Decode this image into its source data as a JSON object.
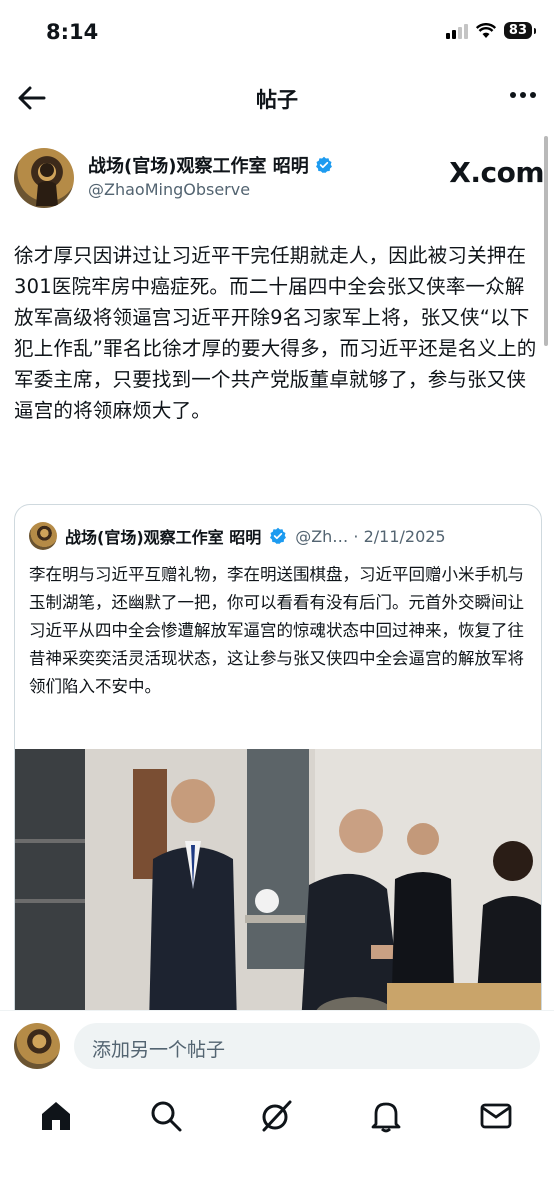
{
  "status_bar": {
    "time": "8:14",
    "battery": "83"
  },
  "header": {
    "title": "帖子"
  },
  "post": {
    "author_name": "战场(官场)观察工作室 昭明",
    "author_handle": "@ZhaoMingObserve",
    "watermark": "X.com",
    "text": "徐才厚只因讲过让习近平干完任期就走人，因此被习关押在301医院牢房中癌症死。而二十届四中全会张又侠率一众解放军高级将领逼宫习近平开除9名习家军上将，张又侠“以下犯上作乱”罪名比徐才厚的要大得多，而习近平还是名义上的军委主席，只要找到一个共产党版董卓就够了，参与张又侠逼宫的将领麻烦大了。"
  },
  "quoted_post": {
    "author_name": "战场(官场)观察工作室 昭明",
    "handle_date": "@Zh… · 2/11/2025",
    "text": "李在明与习近平互赠礼物，李在明送围棋盘，习近平回赠小米手机与玉制湖笔，还幽默了一把，你可以看看有没有后门。元首外交瞬间让习近平从四中全会惨遭解放军逼宫的惊魂状态中回过神来，恢复了往昔神采奕奕活灵活现状态，这让参与张又侠四中全会逼宫的解放军将领们陷入不安中。"
  },
  "compose": {
    "placeholder": "添加另一个帖子"
  },
  "tabbar": {
    "icons": [
      "home-icon",
      "search-icon",
      "grok-icon",
      "notifications-icon",
      "messages-icon"
    ]
  },
  "colors": {
    "text": "#0f1419",
    "secondary": "#536471",
    "verified": "#1d9bf0",
    "border": "#cfd9de"
  }
}
